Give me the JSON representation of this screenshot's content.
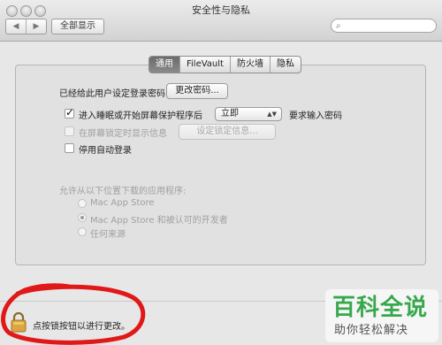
{
  "window": {
    "title": "安全性与隐私"
  },
  "toolbar": {
    "back": "◀",
    "forward": "▶",
    "show_all": "全部显示",
    "search_placeholder": ""
  },
  "tabs": [
    {
      "label": "通用",
      "active": true
    },
    {
      "label": "FileVault",
      "active": false
    },
    {
      "label": "防火墙",
      "active": false
    },
    {
      "label": "隐私",
      "active": false
    }
  ],
  "general": {
    "password_set_label": "已经给此用户设定登录密码",
    "change_password_button": "更改密码...",
    "require_password": {
      "label": "进入睡眠或开始屏幕保护程序后",
      "checked": true,
      "select_value": "立即",
      "suffix": "要求输入密码"
    },
    "show_message": {
      "label": "在屏幕锁定时显示信息",
      "checked": false,
      "disabled": true,
      "button": "设定锁定信息..."
    },
    "disable_autologin": {
      "label": "停用自动登录",
      "checked": false,
      "disabled": true
    }
  },
  "downloads": {
    "heading": "允许从以下位置下载的应用程序:",
    "options": [
      {
        "label": "Mac App Store",
        "selected": false
      },
      {
        "label": "Mac App Store 和被认可的开发者",
        "selected": true
      },
      {
        "label": "任何来源",
        "selected": false
      }
    ]
  },
  "footer": {
    "lock_text": "点按锁按钮以进行更改。"
  },
  "watermark": {
    "title": "百科全说",
    "subtitle": "助你轻松解决"
  },
  "colors": {
    "annotation_red": "#e01818",
    "watermark_green": "#37a84c",
    "active_tab": "#7a7a7a"
  }
}
